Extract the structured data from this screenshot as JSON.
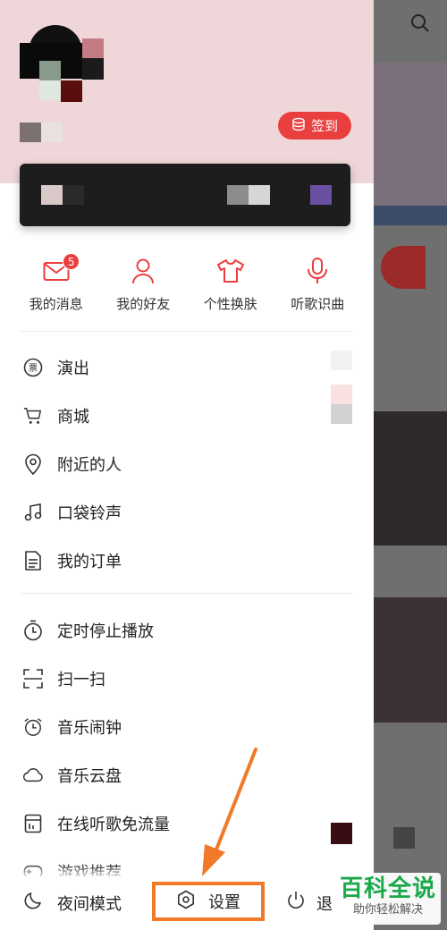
{
  "header": {
    "checkin_label": "签到"
  },
  "quick_actions": [
    {
      "label": "我的消息",
      "icon": "mail-icon",
      "badge": "5"
    },
    {
      "label": "我的好友",
      "icon": "person-icon"
    },
    {
      "label": "个性换肤",
      "icon": "shirt-icon"
    },
    {
      "label": "听歌识曲",
      "icon": "mic-icon"
    }
  ],
  "menu_group_1": [
    {
      "label": "演出",
      "icon": "ticket-icon"
    },
    {
      "label": "商城",
      "icon": "cart-icon"
    },
    {
      "label": "附近的人",
      "icon": "location-pin-icon"
    },
    {
      "label": "口袋铃声",
      "icon": "music-note-icon"
    },
    {
      "label": "我的订单",
      "icon": "document-icon"
    }
  ],
  "menu_group_2": [
    {
      "label": "定时停止播放",
      "icon": "timer-icon"
    },
    {
      "label": "扫一扫",
      "icon": "scan-icon"
    },
    {
      "label": "音乐闹钟",
      "icon": "alarm-clock-icon"
    },
    {
      "label": "音乐云盘",
      "icon": "cloud-icon"
    },
    {
      "label": "在线听歌免流量",
      "icon": "sim-card-icon"
    },
    {
      "label": "游戏推荐",
      "icon": "gamepad-icon"
    }
  ],
  "bottom_bar": {
    "night_mode_label": "夜间模式",
    "settings_label": "设置",
    "logout_label": "退"
  },
  "watermark": {
    "title": "百科全说",
    "subtitle": "助你轻松解决"
  },
  "colors": {
    "accent": "#ea3f3f",
    "header_bg": "#efd7d9",
    "highlight": "#f07a28",
    "watermark_green": "#1aa94b"
  }
}
